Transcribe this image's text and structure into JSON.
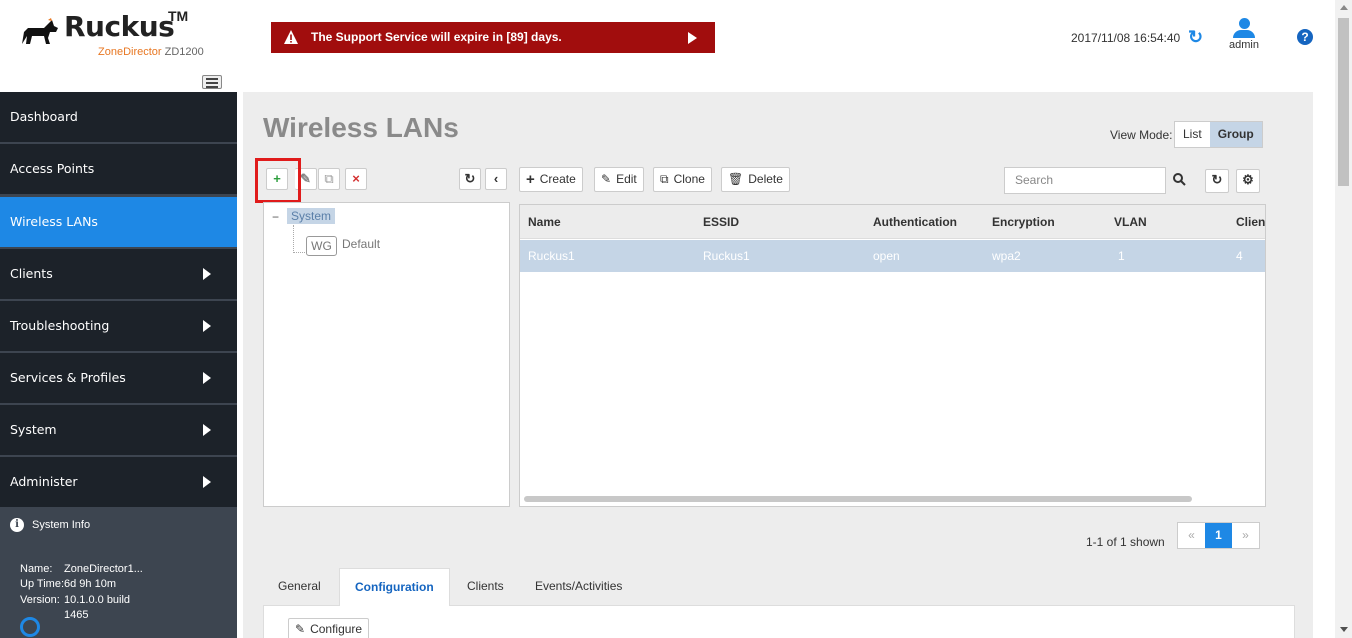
{
  "brand": {
    "name": "Ruckus",
    "tm": "TM",
    "product": "ZoneDirector",
    "model": "ZD1200"
  },
  "alert": {
    "text": "The Support Service will expire in [89] days."
  },
  "header": {
    "datetime": "2017/11/08  16:54:40",
    "user": "admin",
    "help": "?"
  },
  "sidebar": {
    "items": [
      {
        "label": "Dashboard"
      },
      {
        "label": "Access Points"
      },
      {
        "label": "Wireless LANs"
      },
      {
        "label": "Clients"
      },
      {
        "label": "Troubleshooting"
      },
      {
        "label": "Services & Profiles"
      },
      {
        "label": "System"
      },
      {
        "label": "Administer"
      }
    ],
    "sysinfo": {
      "title": "System Info",
      "name_key": "Name:",
      "name_val": "ZoneDirector1...",
      "uptime_key": "Up Time:",
      "uptime_val": "6d 9h 10m",
      "version_key": "Version:",
      "version_val": "10.1.0.0 build",
      "build_val": "1465"
    }
  },
  "page": {
    "title": "Wireless LANs",
    "view_mode_label": "View Mode:",
    "view_list": "List",
    "view_group": "Group"
  },
  "toolbar": {
    "create": "Create",
    "edit": "Edit",
    "clone": "Clone",
    "delete": "Delete",
    "search_placeholder": "Search"
  },
  "tree": {
    "toggle": "−",
    "root": "System",
    "badge": "WG",
    "child": "Default"
  },
  "grid": {
    "columns": [
      "Name",
      "ESSID",
      "Authentication",
      "Encryption",
      "VLAN",
      "Clien"
    ],
    "rows": [
      [
        "Ruckus1",
        "Ruckus1",
        "open",
        "wpa2",
        "1",
        "4"
      ]
    ]
  },
  "pagination": {
    "shown": "1-1 of 1 shown",
    "prev": "«",
    "page": "1",
    "next": "»"
  },
  "tabs": [
    "General",
    "Configuration",
    "Clients",
    "Events/Activities"
  ],
  "tab_body": {
    "configure": "Configure"
  },
  "colors": {
    "accent": "#1e88e5",
    "alert": "#a10d0d",
    "nav_bg": "#1c2229",
    "highlight": "#e01b1b"
  }
}
